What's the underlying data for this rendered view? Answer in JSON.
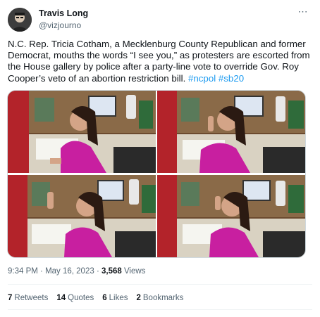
{
  "author": {
    "name": "Travis Long",
    "handle": "@vizjourno"
  },
  "more_icon": "more-horizontal-icon",
  "tweet_text": {
    "main": "N.C. Rep. Tricia Cotham, a Mecklenburg County Republican and former Democrat, mouths the words “I see you,” as protesters are escorted from the House gallery by police after a party-line vote to override Gov. Roy Cooper’s veto of an abortion restriction bill. ",
    "hashtag1": "#ncpol",
    "hashtag2": "#sb20"
  },
  "meta": {
    "time": "9:34 PM",
    "separator": " · ",
    "date": "May 16, 2023",
    "views_count": "3,568",
    "views_label": " Views"
  },
  "stats": {
    "retweets_count": "7",
    "retweets_label": "Retweets",
    "quotes_count": "14",
    "quotes_label": "Quotes",
    "likes_count": "6",
    "likes_label": "Likes",
    "bookmarks_count": "2",
    "bookmarks_label": "Bookmarks"
  },
  "colors": {
    "link": "#1d9bf0",
    "muted": "#536471",
    "text": "#0f1419",
    "photo_red_wall": "#b3232a",
    "photo_magenta_top": "#c81fa0"
  }
}
